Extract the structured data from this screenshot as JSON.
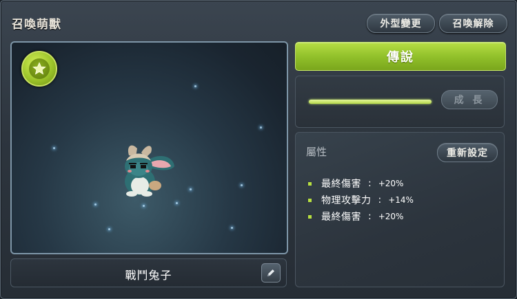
{
  "window": {
    "title": "召喚萌獸",
    "appearance_button": "外型變更",
    "release_button": "召喚解除"
  },
  "pet": {
    "name": "戰鬥兔子",
    "grade_icon": "star-icon",
    "rank_label": "傳說"
  },
  "growth": {
    "button_label": "成 長",
    "progress": 1.0,
    "bar_color": "#c4e86a"
  },
  "attributes": {
    "title": "屬性",
    "reset_button": "重新設定",
    "stats": [
      {
        "name": "最終傷害",
        "sep": ":",
        "value": "+20%"
      },
      {
        "name": "物理攻擊力",
        "sep": ":",
        "value": "+14%"
      },
      {
        "name": "最終傷害",
        "sep": ":",
        "value": "+20%"
      }
    ]
  },
  "colors": {
    "accent_green": "#9cc42a",
    "bullet": "#b8e040"
  }
}
